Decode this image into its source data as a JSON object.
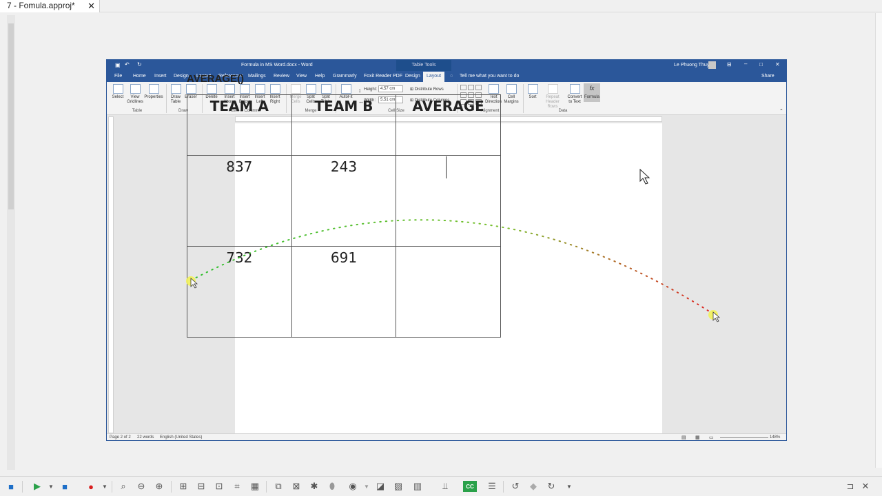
{
  "outer": {
    "tab_title": "7 - Fomula.approj*",
    "close_glyph": "✕"
  },
  "word": {
    "title": "Formula in MS Word.docx - Word",
    "context_tab": "Table Tools",
    "user": "Le Phuong Thuy",
    "menu": [
      "File",
      "Home",
      "Insert",
      "Design",
      "Layout",
      "References",
      "Mailings",
      "Review",
      "View",
      "Help",
      "Grammarly",
      "Foxit Reader PDF",
      "Design",
      "Layout"
    ],
    "active_menu_index": 13,
    "tell_me": "Tell me what you want to do",
    "share": "Share",
    "ribbon": {
      "table_group": {
        "select": "Select",
        "view_gridlines": "View Gridlines",
        "properties": "Properties",
        "label": "Table"
      },
      "draw_group": {
        "draw_table": "Draw Table",
        "eraser": "Eraser",
        "label": "Draw"
      },
      "rows_cols_group": {
        "delete": "Delete",
        "insert_above": "Insert Above",
        "insert_below": "Insert Below",
        "insert_left": "Insert Left",
        "insert_right": "Insert Right",
        "label": "Rows & Columns"
      },
      "merge_group": {
        "merge_cells": "Merge Cells",
        "split_cells": "Split Cells",
        "split_table": "Split Table",
        "label": "Merge"
      },
      "cell_size_group": {
        "autofit": "AutoFit",
        "height_label": "Height:",
        "height_value": "4.57 cm",
        "width_label": "Width:",
        "width_value": "5.51 cm",
        "distribute_rows": "Distribute Rows",
        "distribute_columns": "Distribute Columns",
        "label": "Cell Size"
      },
      "alignment_group": {
        "text_direction": "Text Direction",
        "cell_margins": "Cell Margins",
        "label": "Alignment"
      },
      "data_group": {
        "sort": "Sort",
        "repeat_header": "Repeat Header Rows",
        "convert_text": "Convert to Text",
        "formula": "Formula",
        "label": "Data"
      }
    },
    "status": {
      "page": "Page 2 of 2",
      "words": "22 words",
      "language": "English (United States)",
      "zoom": "148%"
    }
  },
  "document": {
    "heading": "AVERAGE()",
    "table": {
      "headers": [
        "TEAM A",
        "TEAM B",
        "AVERAGE"
      ],
      "rows": [
        [
          "837",
          "243",
          ""
        ],
        [
          "732",
          "691",
          ""
        ]
      ]
    }
  },
  "colors": {
    "word_blue": "#2b579a",
    "click_start": "#f2f25a",
    "path_start": "#2fbf2f",
    "path_end": "#e02020"
  }
}
